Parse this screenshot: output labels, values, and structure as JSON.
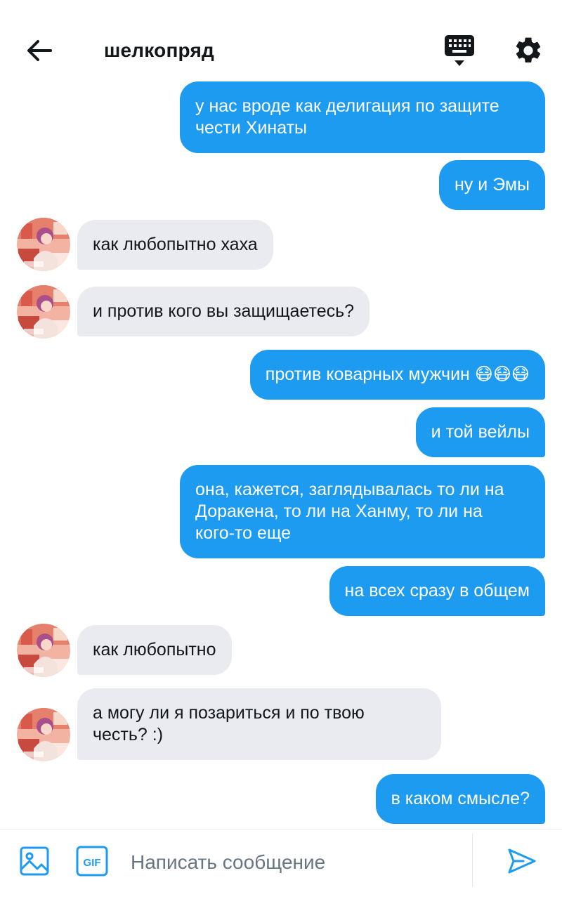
{
  "header": {
    "title": "шелкопряд",
    "back_icon": "arrow-left-icon",
    "keyboard_icon": "keyboard-icon",
    "settings_icon": "gear-icon"
  },
  "messages": [
    {
      "side": "out",
      "text": "у нас вроде как делигация по защите\nчести Хинаты"
    },
    {
      "side": "out",
      "text": "ну и Эмы"
    },
    {
      "side": "in",
      "text": "как любопытно хаха"
    },
    {
      "side": "in",
      "text": "и против кого вы защищаетесь?"
    },
    {
      "side": "out",
      "text": "против коварных мужчин 😷😷😷"
    },
    {
      "side": "out",
      "text": "и той вейлы"
    },
    {
      "side": "out",
      "text": "она, кажется, заглядывалась то ли на\nДоракена, то ли на Ханму, то ли на\nкого-то еще"
    },
    {
      "side": "out",
      "text": "на всех сразу в общем"
    },
    {
      "side": "in",
      "text": "как любопытно"
    },
    {
      "side": "in",
      "text": "а могу ли я позариться и по твою\nчесть? :)"
    },
    {
      "side": "out",
      "text": "в каком смысле?"
    }
  ],
  "composer": {
    "placeholder": "Написать сообщение",
    "value": "",
    "image_icon": "image-icon",
    "gif_label": "GIF",
    "send_icon": "send-icon"
  },
  "colors": {
    "accent": "#1d9bf0",
    "incoming_bubble": "#e9ebf0",
    "text": "#14171a",
    "placeholder": "#687684"
  }
}
